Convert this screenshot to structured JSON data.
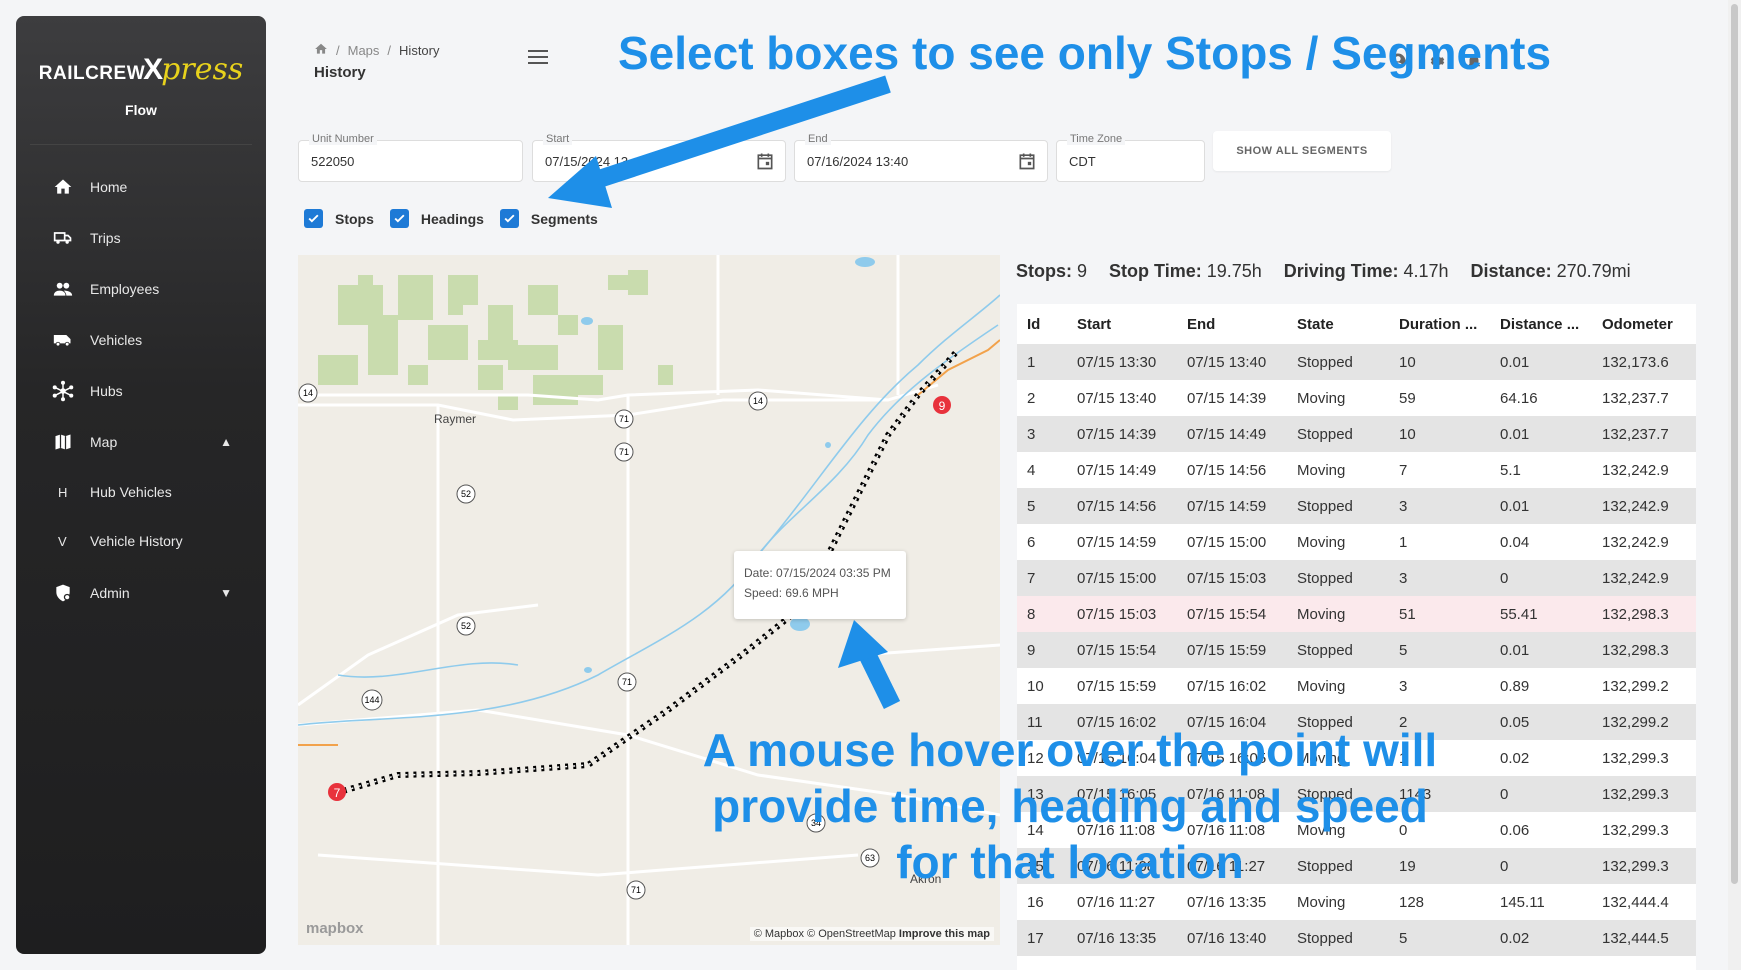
{
  "logo": {
    "part1": "RAILCREW",
    "part2": "X",
    "part3": "press"
  },
  "app_name": "Flow",
  "nav": [
    {
      "label": "Home",
      "icon": "home-icon"
    },
    {
      "label": "Trips",
      "icon": "truck-icon"
    },
    {
      "label": "Employees",
      "icon": "people-icon"
    },
    {
      "label": "Vehicles",
      "icon": "van-icon"
    },
    {
      "label": "Hubs",
      "icon": "hub-icon"
    },
    {
      "label": "Map",
      "icon": "map-icon"
    },
    {
      "label": "Hub Vehicles",
      "letter": "H"
    },
    {
      "label": "Vehicle History",
      "letter": "V"
    },
    {
      "label": "Admin",
      "icon": "shield-icon"
    }
  ],
  "breadcrumb": {
    "maps": "Maps",
    "history": "History"
  },
  "page_title": "History",
  "fields": {
    "unit_label": "Unit Number",
    "unit_value": "522050",
    "start_label": "Start",
    "start_value": "07/15/2024 13",
    "end_label": "End",
    "end_value": "07/16/2024 13:40",
    "tz_label": "Time Zone",
    "tz_value": "CDT"
  },
  "show_all_segments": "SHOW ALL SEGMENTS",
  "checkboxes": {
    "stops": "Stops",
    "headings": "Headings",
    "segments": "Segments"
  },
  "map": {
    "places": {
      "raymer": "Raymer",
      "akron": "Akron"
    },
    "route_shields": [
      "14",
      "14",
      "71",
      "71",
      "52",
      "52",
      "71",
      "144",
      "34",
      "63",
      "71"
    ],
    "markers": [
      "9",
      "7"
    ],
    "tooltip_date": "Date: 07/15/2024 03:35 PM",
    "tooltip_speed": "Speed: 69.6 MPH",
    "attribution_1": "© Mapbox © OpenStreetMap",
    "attribution_2": "Improve this map",
    "logo": "mapbox"
  },
  "stats": {
    "stops_label": "Stops:",
    "stops_value": "9",
    "stop_time_label": "Stop Time:",
    "stop_time_value": "19.75h",
    "driving_label": "Driving Time:",
    "driving_value": "4.17h",
    "distance_label": "Distance:",
    "distance_value": "270.79mi"
  },
  "table": {
    "headers": [
      "Id",
      "Start",
      "End",
      "State",
      "Duration ...",
      "Distance ...",
      "Odometer"
    ],
    "rows": [
      [
        "1",
        "07/15 13:30",
        "07/15 13:40",
        "Stopped",
        "10",
        "0.01",
        "132,173.6"
      ],
      [
        "2",
        "07/15 13:40",
        "07/15 14:39",
        "Moving",
        "59",
        "64.16",
        "132,237.7"
      ],
      [
        "3",
        "07/15 14:39",
        "07/15 14:49",
        "Stopped",
        "10",
        "0.01",
        "132,237.7"
      ],
      [
        "4",
        "07/15 14:49",
        "07/15 14:56",
        "Moving",
        "7",
        "5.1",
        "132,242.9"
      ],
      [
        "5",
        "07/15 14:56",
        "07/15 14:59",
        "Stopped",
        "3",
        "0.01",
        "132,242.9"
      ],
      [
        "6",
        "07/15 14:59",
        "07/15 15:00",
        "Moving",
        "1",
        "0.04",
        "132,242.9"
      ],
      [
        "7",
        "07/15 15:00",
        "07/15 15:03",
        "Stopped",
        "3",
        "0",
        "132,242.9"
      ],
      [
        "8",
        "07/15 15:03",
        "07/15 15:54",
        "Moving",
        "51",
        "55.41",
        "132,298.3"
      ],
      [
        "9",
        "07/15 15:54",
        "07/15 15:59",
        "Stopped",
        "5",
        "0.01",
        "132,298.3"
      ],
      [
        "10",
        "07/15 15:59",
        "07/15 16:02",
        "Moving",
        "3",
        "0.89",
        "132,299.2"
      ],
      [
        "11",
        "07/15 16:02",
        "07/15 16:04",
        "Stopped",
        "2",
        "0.05",
        "132,299.2"
      ],
      [
        "12",
        "07/15 16:04",
        "07/15 16:05",
        "Moving",
        "1",
        "0.02",
        "132,299.3"
      ],
      [
        "13",
        "07/15 16:05",
        "07/16 11:08",
        "Stopped",
        "1143",
        "0",
        "132,299.3"
      ],
      [
        "14",
        "07/16 11:08",
        "07/16 11:08",
        "Moving",
        "0",
        "0.06",
        "132,299.3"
      ],
      [
        "15",
        "07/16 11:08",
        "07/16 11:27",
        "Stopped",
        "19",
        "0",
        "132,299.3"
      ],
      [
        "16",
        "07/16 11:27",
        "07/16 13:35",
        "Moving",
        "128",
        "145.11",
        "132,444.4"
      ],
      [
        "17",
        "07/16 13:35",
        "07/16 13:40",
        "Stopped",
        "5",
        "0.02",
        "132,444.5"
      ]
    ],
    "highlighted_row": 8
  },
  "annotations": {
    "top": "Select boxes to see only Stops / Segments",
    "bottom": "A mouse hover over the point will provide time, heading and speed for that location"
  },
  "colors": {
    "accent": "#1e7ad6",
    "annotation": "#1e8fe8",
    "marker": "#e8323c",
    "logo_yellow": "#e8d21c"
  }
}
